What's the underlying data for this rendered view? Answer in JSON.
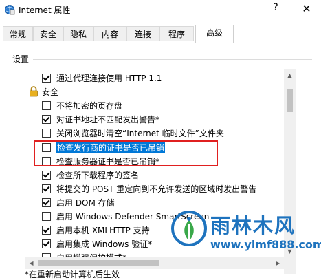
{
  "window": {
    "title": "Internet 属性",
    "help_glyph": "?",
    "close_glyph": "✕"
  },
  "tabs": [
    {
      "label": "常规"
    },
    {
      "label": "安全"
    },
    {
      "label": "隐私"
    },
    {
      "label": "内容"
    },
    {
      "label": "连接"
    },
    {
      "label": "程序"
    },
    {
      "label": "高级",
      "active": true
    }
  ],
  "settings": {
    "group_label": "设置",
    "items": [
      {
        "label": "通过代理连接使用 HTTP 1.1",
        "checked": true
      },
      {
        "label": "安全",
        "type": "category",
        "icon": "lock-icon"
      },
      {
        "label": "不将加密的页存盘",
        "checked": false
      },
      {
        "label": "对证书地址不匹配发出警告*",
        "checked": true
      },
      {
        "label": "关闭浏览器时清空“Internet 临时文件”文件夹",
        "checked": false
      },
      {
        "label": "检查发行商的证书是否已吊销",
        "checked": false,
        "highlighted": true
      },
      {
        "label": "检查服务器证书是否已吊销*",
        "checked": false
      },
      {
        "label": "检查所下载程序的签名",
        "checked": true
      },
      {
        "label": "将提交的 POST 重定向到不允许发送的区域时发出警告",
        "checked": true
      },
      {
        "label": "启用 DOM 存储",
        "checked": true
      },
      {
        "label": "启用 Windows Defender SmartScreen",
        "checked": false
      },
      {
        "label": "启用本机 XMLHTTP 支持",
        "checked": true
      },
      {
        "label": "启用集成 Windows 验证*",
        "checked": true
      },
      {
        "label": "启用增强保护模式*",
        "checked": false
      }
    ]
  },
  "footer_note": "*在重新启动计算机后生效",
  "watermark": {
    "brand": "雨林木风",
    "url": "www.ylmf888.com"
  },
  "colors": {
    "selection": "#0078d7",
    "annotation": "#e02020",
    "watermark": "#1e73be"
  }
}
